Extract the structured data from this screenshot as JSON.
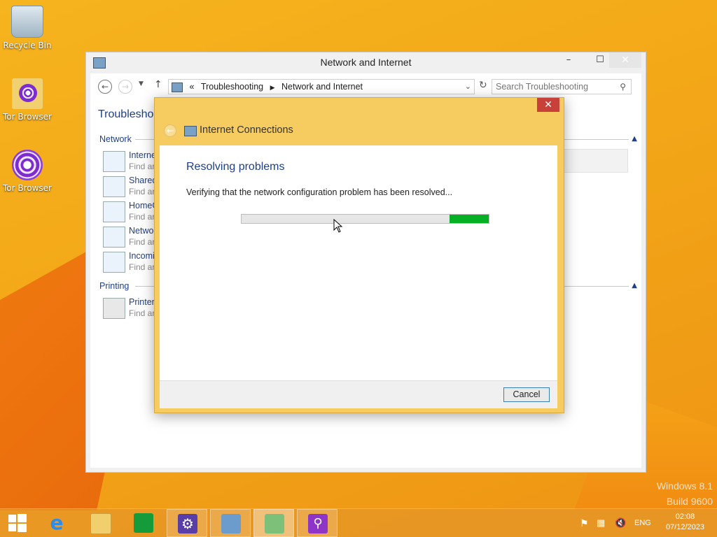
{
  "desktop": {
    "icons": [
      {
        "label": "Recycle Bin"
      },
      {
        "label": "Tor Browser"
      },
      {
        "label": "Tor Browser"
      }
    ],
    "watermark_line1": "Windows 8.1",
    "watermark_line2": "Build 9600"
  },
  "explorer": {
    "title": "Network and Internet",
    "controls": {
      "minimize": "–",
      "maximize": "☐",
      "close": "✕"
    },
    "breadcrumb": {
      "prefix": "«",
      "item1": "Troubleshooting",
      "item2": "Network and Internet"
    },
    "search_placeholder": "Search Troubleshooting",
    "page_title": "Troublesho",
    "sections": {
      "network": "Network",
      "printing": "Printing"
    },
    "items": [
      {
        "title": "Interne",
        "desc": "Find ar"
      },
      {
        "title": "Shared",
        "desc": "Find ar"
      },
      {
        "title": "HomeG",
        "desc": "Find ar"
      },
      {
        "title": "Netwo",
        "desc": "Find ar"
      },
      {
        "title": "Incomi",
        "desc": "Find ar"
      },
      {
        "title": "Printer",
        "desc": "Find ar"
      }
    ]
  },
  "dialog": {
    "close": "✕",
    "header": "Internet Connections",
    "heading": "Resolving problems",
    "message": "Verifying that the network configuration problem has been resolved...",
    "progress": {
      "segment_start": 0.84,
      "segment_end": 1.0,
      "color": "#06b025"
    },
    "cancel_label": "Cancel"
  },
  "taskbar": {
    "apps": [
      "start-button",
      "internet-explorer",
      "file-explorer",
      "store",
      "settings",
      "control-panel",
      "troubleshooter",
      "search"
    ],
    "active": "troubleshooter",
    "language": "ENG",
    "time": "02:08",
    "date": "07/12/2023"
  }
}
